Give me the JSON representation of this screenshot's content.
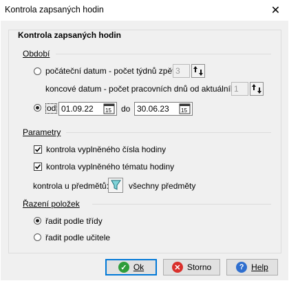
{
  "window": {
    "title": "Kontrola zapsaných hodin",
    "close_glyph": "✕"
  },
  "group": {
    "title": "Kontrola zapsaných hodin"
  },
  "obdobi": {
    "label": "Období",
    "option_weeks": {
      "label": "počáteční datum - počet týdnů zpět:",
      "value": "3",
      "selected": false
    },
    "end_days": {
      "label": "koncové datum - počet pracovních dnů od aktuálního:",
      "value": "1"
    },
    "option_range": {
      "label": "od",
      "selected": true,
      "from": "01.09.22",
      "to_label": "do",
      "to": "30.06.23"
    }
  },
  "parametry": {
    "label": "Parametry",
    "check_number": {
      "label": "kontrola vyplněného čísla hodiny",
      "checked": true
    },
    "check_topic": {
      "label": "kontrola vyplněného tématu hodiny",
      "checked": true
    },
    "subjects_label": "kontrola u předmětů:",
    "subjects_value": "všechny předměty"
  },
  "razeni": {
    "label": "Řazení položek",
    "by_class": {
      "label": "řadit podle třídy",
      "selected": true
    },
    "by_teacher": {
      "label": "řadit podle učitele",
      "selected": false
    }
  },
  "buttons": {
    "ok": "Ok",
    "storno": "Storno",
    "help": "Help"
  },
  "colors": {
    "ok_icon": "#2e9d3a",
    "storno_icon": "#d9302c",
    "help_icon": "#2f6fcf",
    "default_border": "#0078d7"
  }
}
